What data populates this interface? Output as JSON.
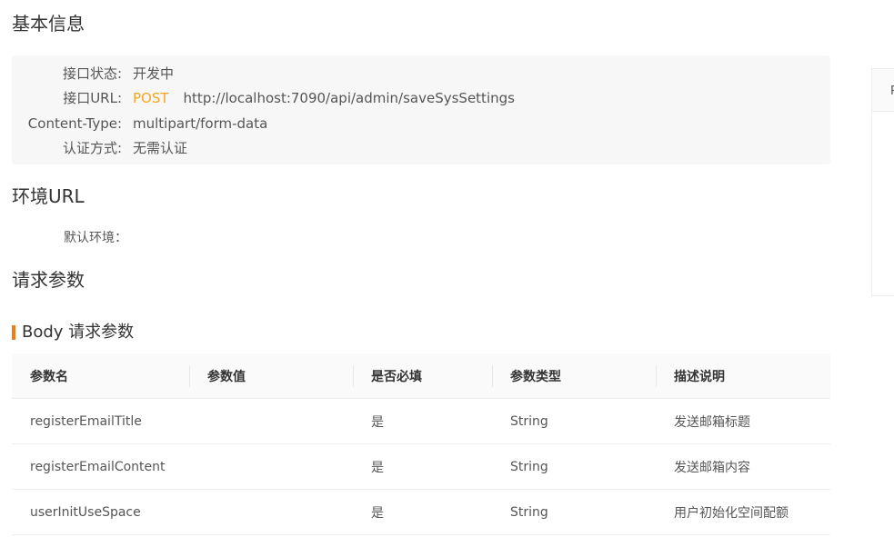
{
  "basic_info": {
    "title": "基本信息",
    "rows": [
      {
        "label": "接口状态:",
        "value": "开发中"
      },
      {
        "label": "接口URL:",
        "method": "POST",
        "value": "http://localhost:7090/api/admin/saveSysSettings"
      },
      {
        "label": "Content-Type:",
        "value": "multipart/form-data"
      },
      {
        "label": "认证方式:",
        "value": "无需认证"
      }
    ]
  },
  "env": {
    "title": "环境URL",
    "default_label": "默认环境："
  },
  "request": {
    "title": "请求参数",
    "body_title": "Body 请求参数",
    "columns": [
      "参数名",
      "参数值",
      "是否必填",
      "参数类型",
      "描述说明"
    ],
    "rows": [
      {
        "name": "registerEmailTitle",
        "value": "",
        "required": "是",
        "type": "String",
        "desc": "发送邮箱标题"
      },
      {
        "name": "registerEmailContent",
        "value": "",
        "required": "是",
        "type": "String",
        "desc": "发送邮箱内容"
      },
      {
        "name": "userInitUseSpace",
        "value": "",
        "required": "是",
        "type": "String",
        "desc": "用户初始化空间配额"
      }
    ]
  },
  "side_panel": {
    "header_text": "R"
  },
  "colors": {
    "method": "#f5a623",
    "accent_bar": "#f07c1e"
  }
}
